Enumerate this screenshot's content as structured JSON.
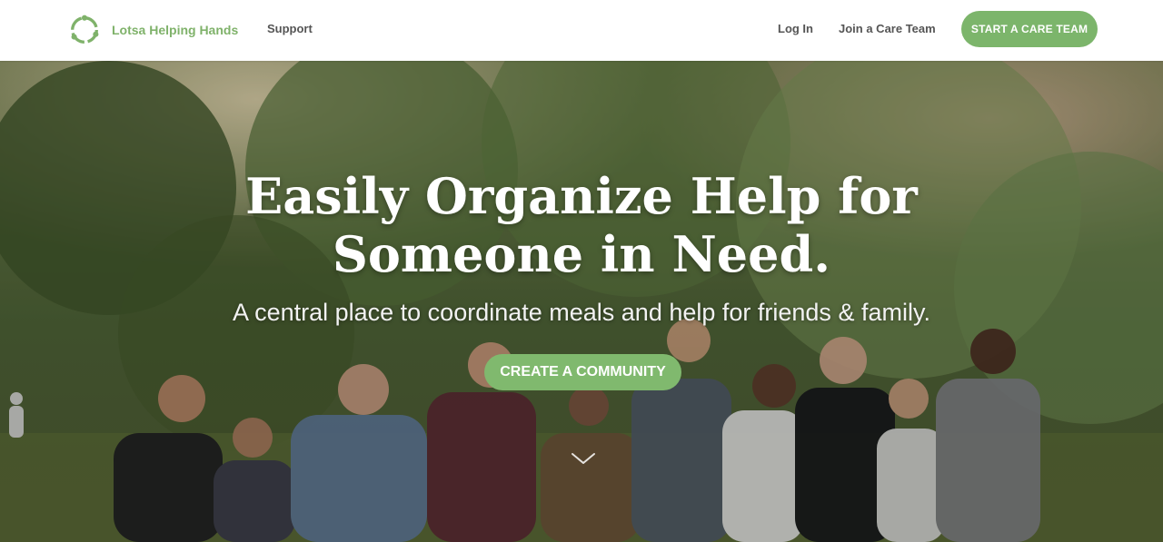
{
  "nav": {
    "brand": "Lotsa Helping Hands",
    "support": "Support",
    "login": "Log In",
    "join": "Join a Care Team",
    "start": "START A CARE TEAM"
  },
  "hero": {
    "title": "Easily Organize Help for Someone in Need.",
    "subtitle": "A central place to coordinate meals and help for friends & family.",
    "cta": "CREATE A COMMUNITY",
    "background_description": "group photo of smiling people arm in arm in a park"
  },
  "colors": {
    "brand_green": "#7fb26a",
    "button_green": "#7cb56b",
    "nav_text": "#555555"
  }
}
